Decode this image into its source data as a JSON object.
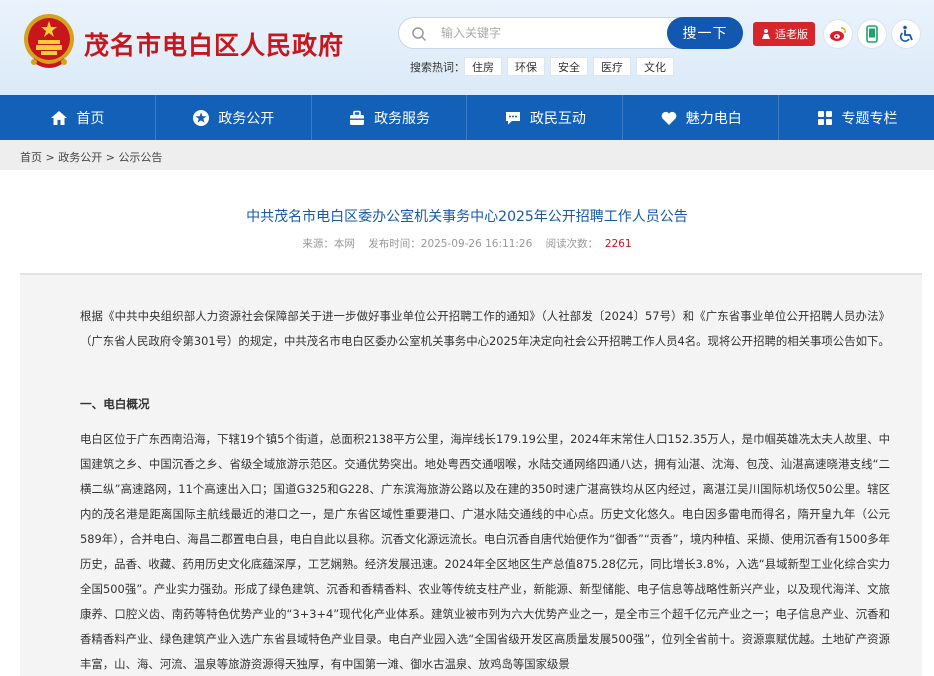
{
  "header": {
    "site_title": "茂名市电白区人民政府",
    "search_placeholder": "输入关键字",
    "search_button": "搜一下",
    "elder_mode": "适老版",
    "hot_label": "搜索热词：",
    "hot_tags": [
      "住房",
      "环保",
      "安全",
      "医疗",
      "文化"
    ],
    "icons": [
      "weibo-icon",
      "mobile-icon",
      "accessibility-icon"
    ],
    "brand_color": "#c8161d",
    "accent_color": "#1260b8"
  },
  "nav": {
    "items": [
      {
        "label": "首页",
        "icon": "home-icon"
      },
      {
        "label": "政务公开",
        "icon": "star-icon"
      },
      {
        "label": "政务服务",
        "icon": "service-icon"
      },
      {
        "label": "政民互动",
        "icon": "chat-icon"
      },
      {
        "label": "魅力电白",
        "icon": "heart-icon"
      },
      {
        "label": "专题专栏",
        "icon": "column-icon"
      }
    ]
  },
  "breadcrumb": {
    "items": [
      "首页",
      "政务公开",
      "公示公告"
    ],
    "separator": ">"
  },
  "article": {
    "title": "中共茂名市电白区委办公室机关事务中心2025年公开招聘工作人员公告",
    "source_label": "来源：",
    "source": "本网",
    "date_label": "发布时间：",
    "date": "2025-09-26 16:11:26",
    "views_label": "阅读次数：",
    "views": "2261",
    "intro": "根据《中共中央组织部人力资源社会保障部关于进一步做好事业单位公开招聘工作的通知》（人社部发〔2024〕57号）和《广东省事业单位公开招聘人员办法》（广东省人民政府令第301号）的规定，中共茂名市电白区委办公室机关事务中心2025年决定向社会公开招聘工作人员4名。现将公开招聘的相关事项公告如下。",
    "section1_heading": "一、电白概况",
    "section1_text": "电白区位于广东西南沿海，下辖19个镇5个街道，总面积2138平方公里，海岸线长179.19公里，2024年末常住人口152.35万人，是巾帼英雄冼太夫人故里、中国建筑之乡、中国沉香之乡、省级全域旅游示范区。交通优势突出。地处粤西交通咽喉，水陆交通网络四通八达，拥有汕湛、沈海、包茂、汕湛高速晓港支线“二横二纵”高速路网，11个高速出入口；国道G325和G228、广东滨海旅游公路以及在建的350时速广湛高铁均从区内经过，离湛江吴川国际机场仅50公里。辖区内的茂名港是距离国际主航线最近的港口之一，是广东省区域性重要港口、广湛水陆交通线的中心点。历史文化悠久。电白因多雷电而得名，隋开皇九年（公元589年），合并电白、海昌二郡置电白县，电白自此以县称。沉香文化源远流长。电白沉香自唐代始便作为“御香”“贡香”，境内种植、采撷、使用沉香有1500多年历史，品香、收藏、药用历史文化底蕴深厚，工艺娴熟。经济发展迅速。2024年全区地区生产总值875.28亿元，同比增长3.8%，入选“县域新型工业化综合实力全国500强”。产业实力强劲。形成了绿色建筑、沉香和香精香料、农业等传统支柱产业，新能源、新型储能、电子信息等战略性新兴产业，以及现代海洋、文旅康养、口腔义齿、南药等特色优势产业的“3+3+4”现代化产业体系。建筑业被市列为六大优势产业之一，是全市三个超千亿元产业之一；电子信息产业、沉香和香精香料产业、绿色建筑产业入选广东省县域特色产业目录。电白产业园入选“全国省级开发区高质量发展500强”，位列全省前十。资源禀赋优越。土地矿产资源丰富，山、海、河流、温泉等旅游资源得天独厚，有中国第一滩、御水古温泉、放鸡岛等国家级景"
  }
}
